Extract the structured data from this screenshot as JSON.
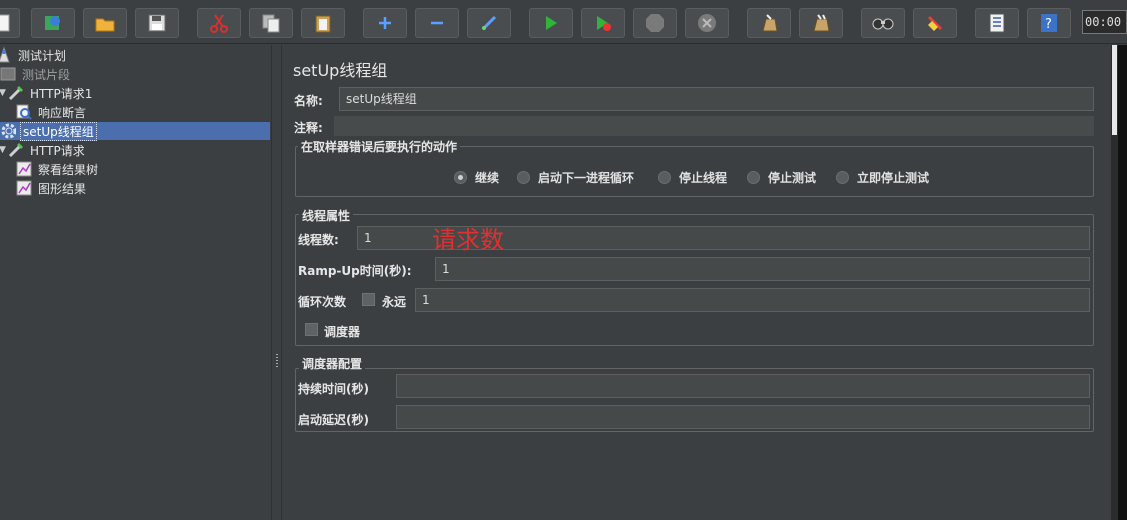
{
  "toolbar": {
    "buttons": [
      {
        "icon": "new-icon"
      },
      {
        "icon": "templates-icon"
      },
      {
        "icon": "open-icon"
      },
      {
        "icon": "save-icon"
      },
      {
        "icon": "cut-icon"
      },
      {
        "icon": "copy-icon"
      },
      {
        "icon": "paste-icon"
      },
      {
        "icon": "expand-icon"
      },
      {
        "icon": "collapse-icon"
      },
      {
        "icon": "toggle-icon"
      },
      {
        "icon": "start-icon"
      },
      {
        "icon": "start-no-pause-icon"
      },
      {
        "icon": "stop-icon"
      },
      {
        "icon": "shutdown-icon"
      },
      {
        "icon": "clear-icon"
      },
      {
        "icon": "clear-all-icon"
      },
      {
        "icon": "search-icon"
      },
      {
        "icon": "reset-search-icon"
      },
      {
        "icon": "function-helper-icon"
      },
      {
        "icon": "help-icon"
      }
    ],
    "clock": "00:00"
  },
  "tree": {
    "items": [
      {
        "label": "测试计划",
        "icon": "test-plan-icon"
      },
      {
        "label": "测试片段",
        "icon": "test-fragment-icon"
      },
      {
        "label": "HTTP请求1",
        "icon": "sampler-pipette-icon"
      },
      {
        "label": "响应断言",
        "icon": "assertion-magnifier-icon"
      },
      {
        "label": "setUp线程组",
        "icon": "gear-icon"
      },
      {
        "label": "HTTP请求",
        "icon": "sampler-pipette-icon"
      },
      {
        "label": "察看结果树",
        "icon": "listener-chart-icon"
      },
      {
        "label": "图形结果",
        "icon": "listener-chart-icon"
      }
    ]
  },
  "main": {
    "title": "setUp线程组",
    "name_label": "名称:",
    "name_value": "setUp线程组",
    "comment_label": "注释:",
    "comment_value": "",
    "error_action": {
      "title": "在取样器错误后要执行的动作",
      "options": [
        "继续",
        "启动下一进程循环",
        "停止线程",
        "停止测试",
        "立即停止测试"
      ],
      "selected": "继续"
    },
    "thread_props": {
      "title": "线程属性",
      "threads_label": "线程数:",
      "threads_value": "1",
      "rampup_label": "Ramp-Up时间(秒):",
      "rampup_value": "1",
      "loop_label": "循环次数",
      "forever_label": "永远",
      "forever_checked": false,
      "loop_value": "1",
      "scheduler_label": "调度器",
      "scheduler_checked": false
    },
    "scheduler_config": {
      "title": "调度器配置",
      "duration_label": "持续时间(秒)",
      "duration_value": "",
      "delay_label": "启动延迟(秒)",
      "delay_value": ""
    },
    "annotation": "请求数"
  },
  "colors": {
    "background": "#3c3f41",
    "selection": "#4b6eaf",
    "annotation": "#e03030"
  }
}
